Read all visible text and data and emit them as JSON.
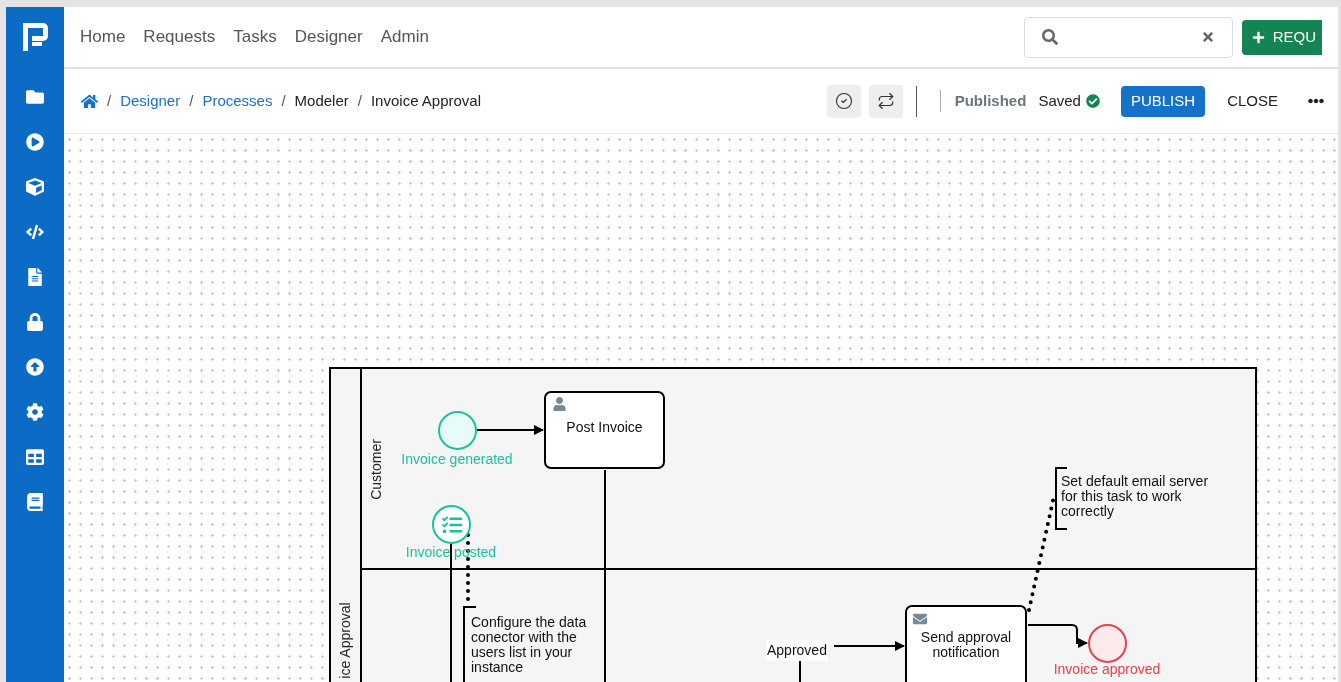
{
  "nav": {
    "items": [
      {
        "label": "Home"
      },
      {
        "label": "Requests"
      },
      {
        "label": "Tasks"
      },
      {
        "label": "Designer"
      },
      {
        "label": "Admin"
      }
    ],
    "new_request_button": "REQU"
  },
  "sidebar": {
    "items": [
      {
        "kind": "folder"
      },
      {
        "kind": "play"
      },
      {
        "kind": "cube"
      },
      {
        "kind": "code"
      },
      {
        "kind": "file"
      },
      {
        "kind": "lock"
      },
      {
        "kind": "up"
      },
      {
        "kind": "gear"
      },
      {
        "kind": "table"
      },
      {
        "kind": "book"
      }
    ]
  },
  "breadcrumb": [
    {
      "separator": "/",
      "label": "Designer",
      "link": true
    },
    {
      "separator": "/",
      "label": "Processes",
      "link": true
    },
    {
      "separator": "/",
      "label": "Modeler",
      "link": false
    },
    {
      "separator": "/",
      "label": "Invoice Approval",
      "link": false
    }
  ],
  "toolbar": {
    "status": "Published",
    "saved": "Saved",
    "publish": "PUBLISH",
    "close": "CLOSE"
  },
  "diagram": {
    "pool": "ice Approval",
    "lanes": [
      "Customer"
    ],
    "events": [
      {
        "kind": "start",
        "label": "Invoice generated"
      },
      {
        "kind": "intermediate",
        "label": "Invoice posted"
      },
      {
        "kind": "end",
        "label": "Invoice approved"
      }
    ],
    "tasks": [
      {
        "kind": "user",
        "label": "Post Invoice"
      },
      {
        "kind": "mail",
        "label": "Send approval notification"
      }
    ],
    "flow_labels": [
      "Approved"
    ],
    "annotations": [
      "Configure the data conector with the users list in your instance",
      "Set default email server for this task to work correctly"
    ]
  }
}
